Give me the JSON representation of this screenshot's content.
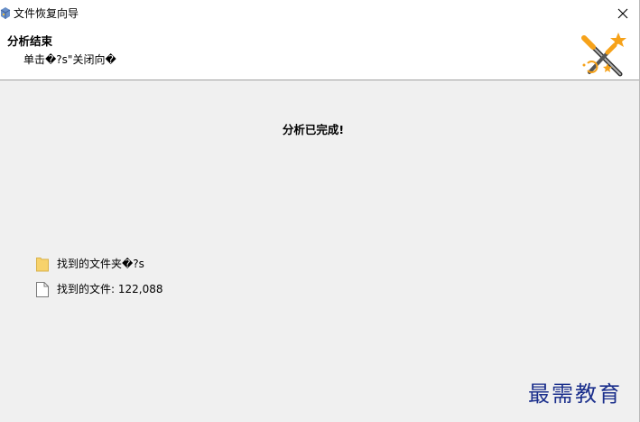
{
  "window": {
    "title": "文件恢复向导"
  },
  "header": {
    "title": "分析结束",
    "subtitle": "单击�?s\"关闭向�"
  },
  "main": {
    "status": "分析已完成!",
    "folders_found": "找到的文件夹�?s",
    "files_found": "找到的文件: 122,088"
  },
  "watermark": {
    "text": "最需教育"
  },
  "icons": {
    "app": "recovery-wizard-app-icon",
    "close": "close-icon",
    "wizard": "magic-wand-icon",
    "folder": "folder-icon",
    "file": "file-icon"
  },
  "colors": {
    "body_bg": "#f0f0f0",
    "header_bg": "#ffffff",
    "folder": "#f7d26b",
    "wand_orange": "#f6a21a",
    "watermark": "#1b2f8c"
  }
}
